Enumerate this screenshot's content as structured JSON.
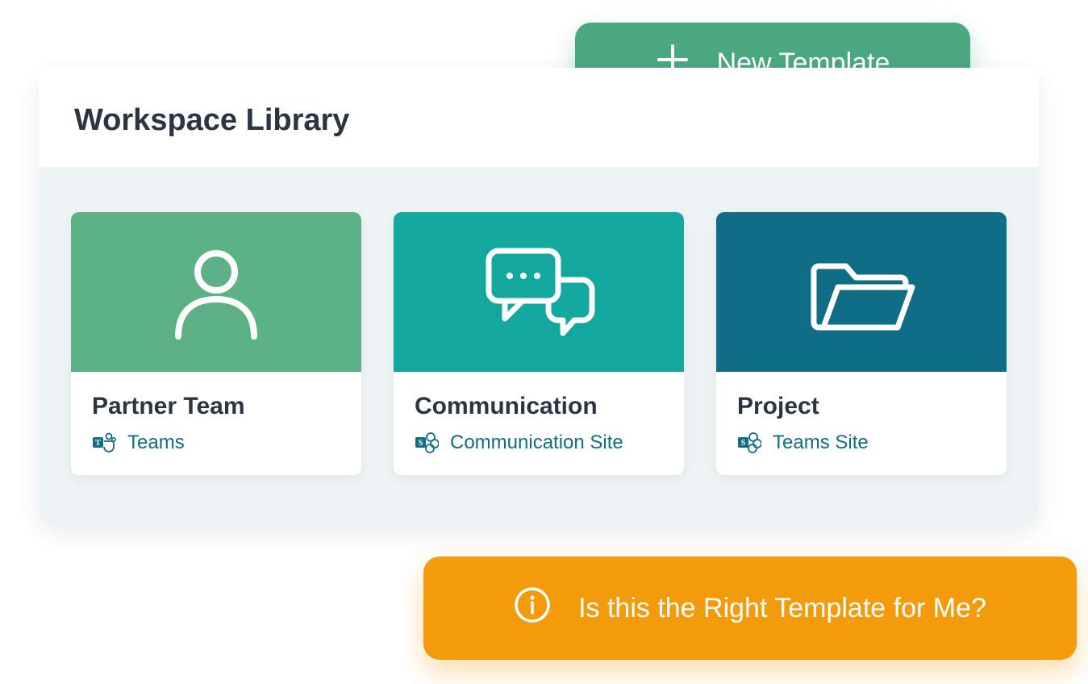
{
  "header": {
    "title": "Workspace Library"
  },
  "new_template_button": {
    "label": "New Template"
  },
  "help_button": {
    "label": "Is this the Right Template for Me?"
  },
  "cards": [
    {
      "title": "Partner Team",
      "subtitle": "Teams",
      "hero_color": "#5cb284",
      "icon": "person"
    },
    {
      "title": "Communication",
      "subtitle": "Communication Site",
      "hero_color": "#13a89e",
      "icon": "chat"
    },
    {
      "title": "Project",
      "subtitle": "Teams Site",
      "hero_color": "#0f6d86",
      "icon": "folder"
    }
  ],
  "colors": {
    "accent_green": "#4ba97f",
    "accent_orange": "#f49b0b",
    "teal_text": "#0f6d86"
  }
}
